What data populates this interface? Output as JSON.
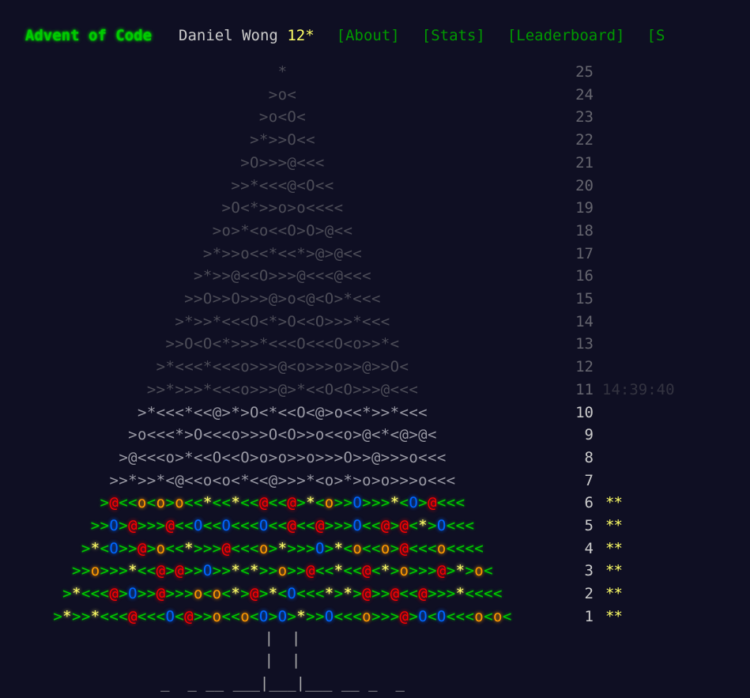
{
  "header": {
    "title": "Advent of Code",
    "user": "Daniel Wong",
    "star_count": "12*",
    "nav": [
      "[About]",
      "[Stats]",
      "[Leaderboard]",
      "[S"
    ]
  },
  "colors": {
    "background": "#0f0f23",
    "title_green": "#00cc00",
    "nav_green": "#009900",
    "gold": "#ffff66",
    "red": "#ff0000",
    "blue": "#0066ff",
    "orange": "#ff9900"
  },
  "calendar": {
    "days": [
      {
        "day": "25",
        "art": "*",
        "state": "dim",
        "stars": "",
        "time": ""
      },
      {
        "day": "24",
        "art": ">o<",
        "state": "dim",
        "stars": "",
        "time": ""
      },
      {
        "day": "23",
        "art": ">o<O<",
        "state": "dim",
        "stars": "",
        "time": ""
      },
      {
        "day": "22",
        "art": ">*>>O<<",
        "state": "dim",
        "stars": "",
        "time": ""
      },
      {
        "day": "21",
        "art": ">O>>>@<<<",
        "state": "dim",
        "stars": "",
        "time": ""
      },
      {
        "day": "20",
        "art": ">>*<<<@<O<<",
        "state": "dim",
        "stars": "",
        "time": ""
      },
      {
        "day": "19",
        "art": ">O<*>>o>o<<<<",
        "state": "dim",
        "stars": "",
        "time": ""
      },
      {
        "day": "18",
        "art": ">o>*<o<<O>O>@<<",
        "state": "dim",
        "stars": "",
        "time": ""
      },
      {
        "day": "17",
        "art": ">*>>o<<*<<*>@>@<<",
        "state": "dim",
        "stars": "",
        "time": ""
      },
      {
        "day": "16",
        "art": ">*>>@<<O>>>@<<<@<<<",
        "state": "dim",
        "stars": "",
        "time": ""
      },
      {
        "day": "15",
        "art": ">>O>>O>>>@>o<@<O>*<<<",
        "state": "dim",
        "stars": "",
        "time": ""
      },
      {
        "day": "14",
        "art": ">*>>*<<<O<*>O<<O>>>*<<<",
        "state": "dim",
        "stars": "",
        "time": ""
      },
      {
        "day": "13",
        "art": ">>O<O<*>>>*<<<O<<<O<o>>*<",
        "state": "dim",
        "stars": "",
        "time": ""
      },
      {
        "day": "12",
        "art": ">*<<<*<<<o>>>@<o>>>o>>@>>O<",
        "state": "dim",
        "stars": "",
        "time": ""
      },
      {
        "day": "11",
        "art": ">>*>>>*<<<o>>>@>*<<O<O>>>@<<<",
        "state": "dim",
        "stars": "",
        "time": "14:39:40"
      },
      {
        "day": "10",
        "art": ">*<<<*<<@>*>O<*<<O<@>o<<*>>*<<<",
        "state": "mid",
        "stars": "",
        "time": ""
      },
      {
        "day": "9",
        "art": ">o<<<*>O<<<o>>>O<O>>o<<o>@<*<@>@<",
        "state": "mid",
        "stars": "",
        "time": ""
      },
      {
        "day": "8",
        "art": ">@<<<o>*<<O<<O>o>o>>o>>>O>>@>>>o<<<",
        "state": "mid",
        "stars": "",
        "time": ""
      },
      {
        "day": "7",
        "art": ">>*>>*<@<<o<o<*<<@>>>*<o>*>o>o>>>o<<<",
        "state": "mid",
        "stars": "",
        "time": ""
      },
      {
        "day": "6",
        "art": ">@<<o<o>o<<*<<*<<@<<@>*<o>>O>>>*<O>@<<<",
        "state": "lit",
        "stars": "**",
        "time": ""
      },
      {
        "day": "5",
        "art": ">>O>@>>>@<<O<<O<<<O<<@<<@>>>O<<@>@<*>O<<<",
        "state": "lit",
        "stars": "**",
        "time": ""
      },
      {
        "day": "4",
        "art": ">*<O>>@>o<<*>>>@<<<o>*>>>O>*<o<<o>@<<<o<<<<",
        "state": "lit",
        "stars": "**",
        "time": ""
      },
      {
        "day": "3",
        "art": ">>o>>>*<<@>@>>O>>*<*>>o>>@<<*<<@<*>o>>>@>*>o<",
        "state": "lit",
        "stars": "**",
        "time": ""
      },
      {
        "day": "2",
        "art": ">*<<<@>O>>@>>>o<o<*>@>*<O<<<*>*>@>>@<<@>>>*<<<<",
        "state": "lit",
        "stars": "**",
        "time": ""
      },
      {
        "day": "1",
        "art": ">*>>*<<<@<<<O<@>>o<<o<O>O>*>>O<<<o>>>@>O<O<<<o<o<",
        "state": "lit",
        "stars": "**",
        "time": ""
      }
    ],
    "trunk": [
      "|  |",
      "|  |",
      "_  _ __ ___|___|___ __ _  _"
    ]
  }
}
